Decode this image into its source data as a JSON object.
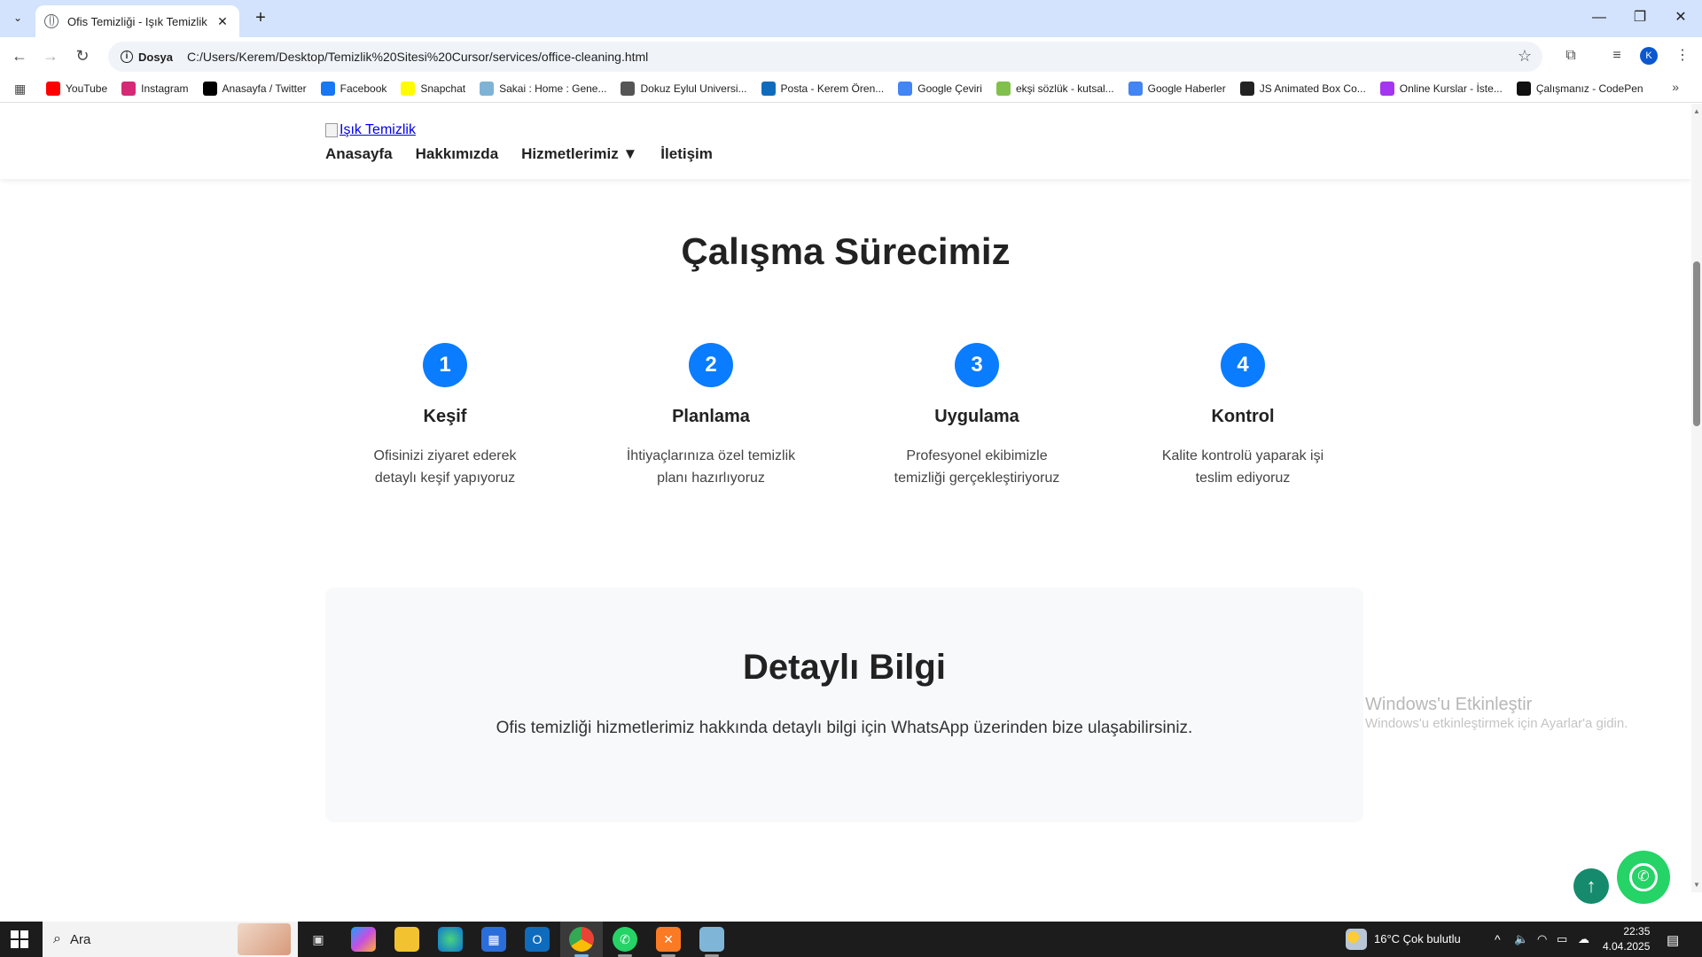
{
  "browser": {
    "tab_title": "Ofis Temizliği - Işık Temizlik",
    "site_info_label": "Dosya",
    "url": "C:/Users/Kerem/Desktop/Temizlik%20Sitesi%20Cursor/services/office-cleaning.html",
    "profile_initial": "K",
    "bookmarks": [
      {
        "label": "YouTube",
        "color": "#ff0000"
      },
      {
        "label": "Instagram",
        "color": "#d62976"
      },
      {
        "label": "Anasayfa / Twitter",
        "color": "#000000"
      },
      {
        "label": "Facebook",
        "color": "#1877f2"
      },
      {
        "label": "Snapchat",
        "color": "#fffc00"
      },
      {
        "label": "Sakai : Home : Gene...",
        "color": "#7fb3d5"
      },
      {
        "label": "Dokuz Eylul Universi...",
        "color": "#555555"
      },
      {
        "label": "Posta - Kerem Ören...",
        "color": "#0f6cbd"
      },
      {
        "label": "Google Çeviri",
        "color": "#4285f4"
      },
      {
        "label": "ekşi sözlük - kutsal...",
        "color": "#81c14b"
      },
      {
        "label": "Google Haberler",
        "color": "#4285f4"
      },
      {
        "label": "JS Animated Box Co...",
        "color": "#222222"
      },
      {
        "label": "Online Kurslar - İste...",
        "color": "#a435f0"
      },
      {
        "label": "Çalışmanız - CodePen",
        "color": "#111111"
      }
    ]
  },
  "header": {
    "logo_alt": "Işık Temizlik",
    "nav": [
      "Anasayfa",
      "Hakkımızda",
      "Hizmetlerimiz ▼",
      "İletişim"
    ]
  },
  "process": {
    "title": "Çalışma Sürecimiz",
    "steps": [
      {
        "num": "1",
        "title": "Keşif",
        "desc": "Ofisinizi ziyaret ederek detaylı keşif yapıyoruz"
      },
      {
        "num": "2",
        "title": "Planlama",
        "desc": "İhtiyaçlarınıza özel temizlik planı hazırlıyoruz"
      },
      {
        "num": "3",
        "title": "Uygulama",
        "desc": "Profesyonel ekibimizle temizliği gerçekleştiriyoruz"
      },
      {
        "num": "4",
        "title": "Kontrol",
        "desc": "Kalite kontrolü yaparak işi teslim ediyoruz"
      }
    ],
    "accent_color": "#0a7cff"
  },
  "details": {
    "title": "Detaylı Bilgi",
    "text": "Ofis temizliği hizmetlerimiz hakkında detaylı bilgi için WhatsApp üzerinden bize ulaşabilirsiniz."
  },
  "watermark": {
    "line1": "Windows'u Etkinleştir",
    "line2": "Windows'u etkinleştirmek için Ayarlar'a gidin."
  },
  "taskbar": {
    "search_placeholder": "Ara",
    "weather": "16°C  Çok bulutlu",
    "time": "22:35",
    "date": "4.04.2025"
  }
}
